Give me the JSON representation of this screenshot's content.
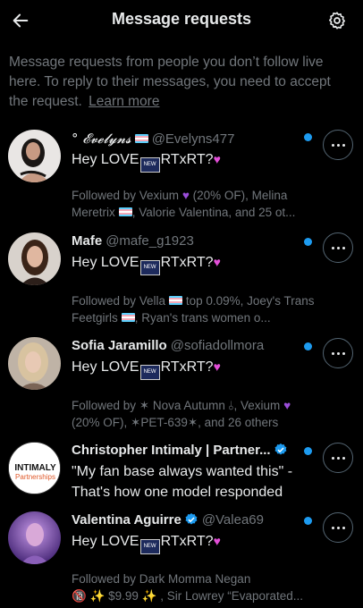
{
  "header": {
    "title": "Message requests",
    "back_icon": "arrow-left-icon",
    "settings_icon": "gear-icon"
  },
  "info": {
    "text": "Message requests from people you don’t follow live here. To reply to their messages, you need to accept the request.",
    "learn_more": "Learn more"
  },
  "colors": {
    "background": "#000000",
    "primary_text": "#e7e9ea",
    "secondary_text": "#71767b",
    "unread_dot": "#1d9bf0",
    "verified": "#1d9bf0"
  },
  "requests": [
    {
      "name": "° 𝓔𝓿𝓮𝓵𝔂𝓷𝓼",
      "handle": "@Evelyns477",
      "message_pre": "Hey LOVE",
      "message_post": "RTxRT?",
      "followed": "Followed by Vexium",
      "followed_2": "(20% OF), Melina Meretrix",
      "followed_3": ", Valorie Valentina, and 25 ot...",
      "unread": true
    },
    {
      "name": "Mafe",
      "handle": "@mafe_g1923",
      "message_pre": "Hey LOVE",
      "message_post": "RTxRT?",
      "followed": "Followed by Vella",
      "followed_2": "top 0.09%, Joey's Trans Feetgirls",
      "followed_3": ", Ryan's trans women o...",
      "unread": true
    },
    {
      "name": "Sofia Jaramillo",
      "handle": "@sofiadollmora",
      "message_pre": "Hey LOVE",
      "message_post": "RTxRT?",
      "followed": "Followed by ✶ Nova Autumn ⫰, Vexium",
      "followed_2": "(20% OF), ✶PET-639✶, and 26 others",
      "unread": true
    },
    {
      "name": "Christopher Intimaly | Partner...",
      "handle": "",
      "message": "\"My fan base always wanted this\" - That's how one model responded",
      "logo_line1": "INTIMALY",
      "logo_line2": "Partnerships",
      "verified": true,
      "unread": true
    },
    {
      "name": "Valentina Aguirre",
      "handle": "@Valea69",
      "message_pre": "Hey LOVE",
      "message_post": "RTxRT?",
      "followed": "Followed by Dark Momma Negan",
      "followed_2": "🔞 ✨ $9.99 ✨ , Sir Lowrey “Evaporated...",
      "verified": true,
      "unread": true
    }
  ]
}
